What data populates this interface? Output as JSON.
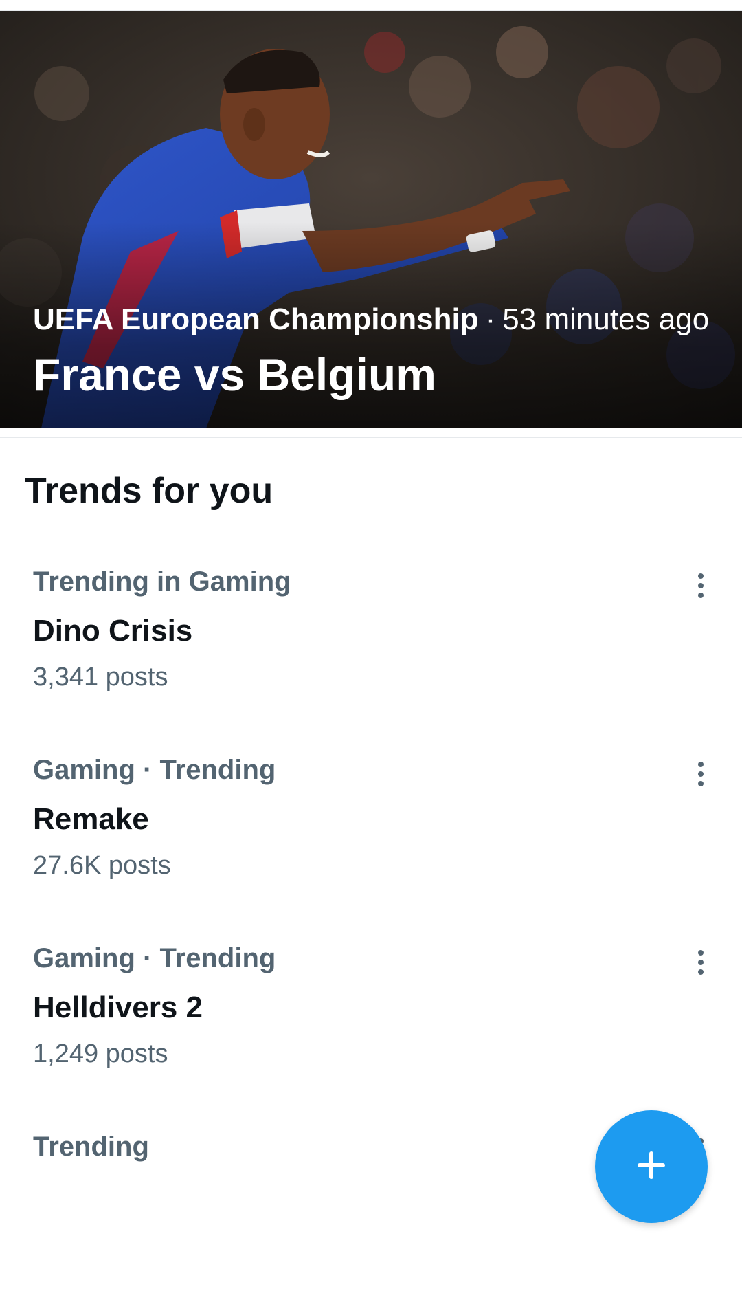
{
  "hero": {
    "category": "UEFA European Championship",
    "separator": "·",
    "time": "53 minutes ago",
    "title": "France vs Belgium"
  },
  "section": {
    "title": "Trends for you"
  },
  "trends": [
    {
      "context": "Trending in Gaming",
      "name": "Dino Crisis",
      "count": "3,341 posts"
    },
    {
      "context": "Gaming · Trending",
      "name": "Remake",
      "count": "27.6K posts"
    },
    {
      "context": "Gaming · Trending",
      "name": "Helldivers 2",
      "count": "1,249 posts"
    },
    {
      "context": "Trending",
      "name": "",
      "count": ""
    }
  ],
  "icons": {
    "more": "more-vertical-icon",
    "compose": "plus-icon"
  },
  "colors": {
    "accent": "#1d9bf0",
    "primary_text": "#0f1419",
    "secondary_text": "#536471",
    "divider": "#e6e9ec"
  }
}
